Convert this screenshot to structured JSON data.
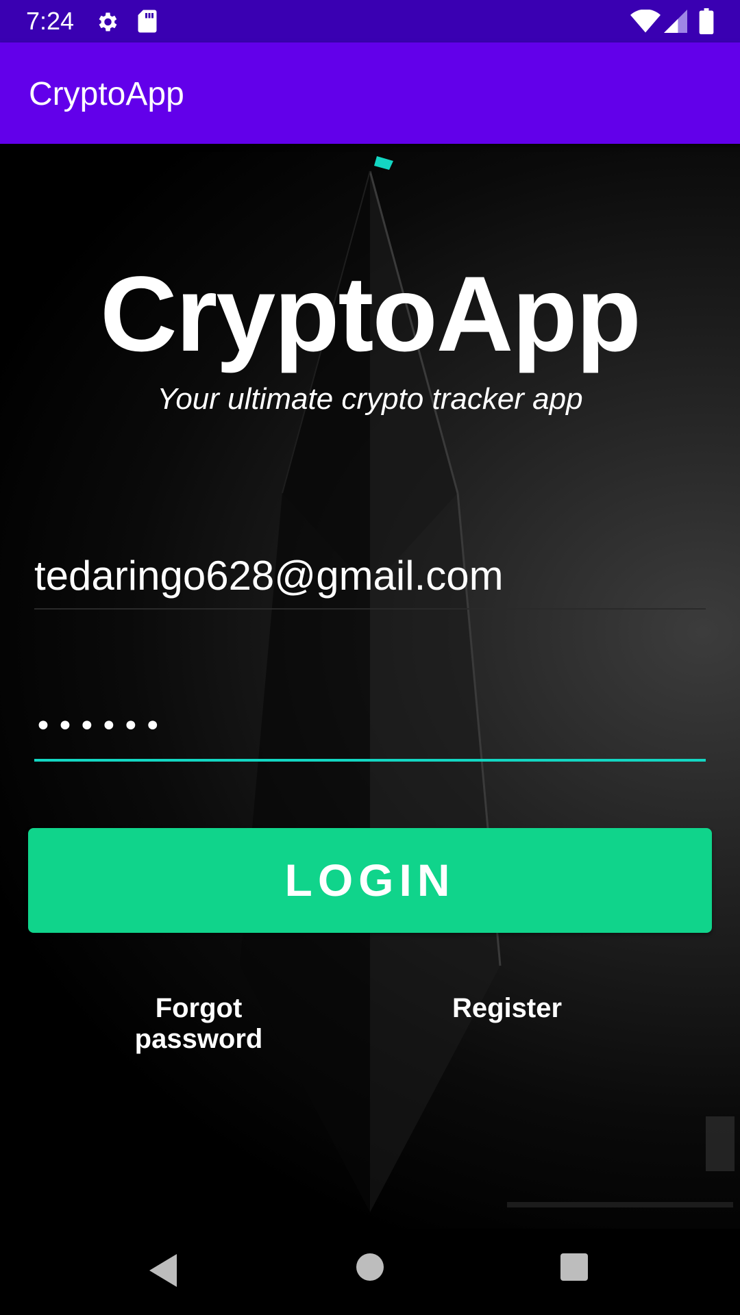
{
  "status_bar": {
    "time": "7:24",
    "icons": [
      "gear-icon",
      "sd-card-icon",
      "wifi-icon",
      "signal-icon",
      "battery-icon"
    ]
  },
  "app_bar": {
    "title": "CryptoApp",
    "color": "#6200ea"
  },
  "hero": {
    "title": "CryptoApp",
    "subtitle": "Your ultimate crypto tracker app"
  },
  "form": {
    "email_value": "tedaringo628@gmail.com",
    "password_mask": "••••••",
    "accent_color": "#13d6c2"
  },
  "login_button": {
    "label": "LOGIN",
    "color": "#10d48b"
  },
  "links": {
    "forgot_password": "Forgot password",
    "register": "Register"
  },
  "nav_bar": {
    "icons": [
      "back-icon",
      "home-icon",
      "recents-icon"
    ]
  }
}
